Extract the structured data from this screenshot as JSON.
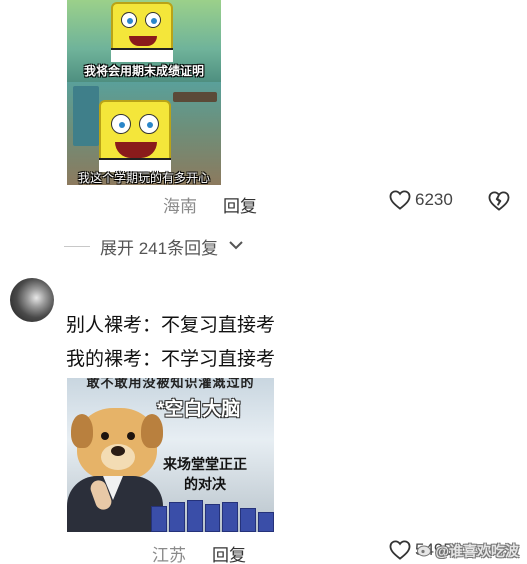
{
  "comments": [
    {
      "image": {
        "caption_top": "我将会用期末成绩证明",
        "caption_bottom": "我这个学期玩的有多开心"
      },
      "location": "海南",
      "reply_label": "回复",
      "like_count": "6230"
    },
    {
      "text_lines": [
        "别人裸考：不复习直接考",
        "我的裸考：不学习直接考"
      ],
      "image": {
        "top_text": "敢不敢用没被知识灌溉过的",
        "title": "*空白大脑",
        "duel_line1": "来场堂堂正正",
        "duel_line2": "的对决"
      },
      "location": "江苏",
      "reply_label": "回复",
      "like_count": "5495"
    }
  ],
  "expand_replies": {
    "label": "展开 241条回复"
  },
  "watermark": {
    "text": "@谁喜欢吃波"
  },
  "icons": {
    "like": "heart-outline-icon",
    "dislike": "broken-heart-icon",
    "expand": "chevron-down-icon"
  }
}
